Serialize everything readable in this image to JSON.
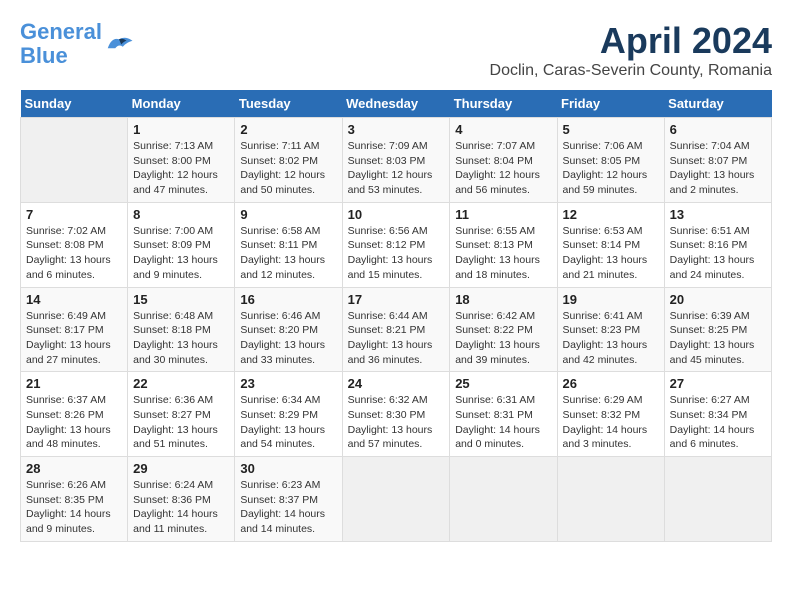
{
  "header": {
    "logo_line1": "General",
    "logo_line2": "Blue",
    "title": "April 2024",
    "subtitle": "Doclin, Caras-Severin County, Romania"
  },
  "calendar": {
    "days_of_week": [
      "Sunday",
      "Monday",
      "Tuesday",
      "Wednesday",
      "Thursday",
      "Friday",
      "Saturday"
    ],
    "weeks": [
      [
        {
          "day": "",
          "info": ""
        },
        {
          "day": "1",
          "info": "Sunrise: 7:13 AM\nSunset: 8:00 PM\nDaylight: 12 hours\nand 47 minutes."
        },
        {
          "day": "2",
          "info": "Sunrise: 7:11 AM\nSunset: 8:02 PM\nDaylight: 12 hours\nand 50 minutes."
        },
        {
          "day": "3",
          "info": "Sunrise: 7:09 AM\nSunset: 8:03 PM\nDaylight: 12 hours\nand 53 minutes."
        },
        {
          "day": "4",
          "info": "Sunrise: 7:07 AM\nSunset: 8:04 PM\nDaylight: 12 hours\nand 56 minutes."
        },
        {
          "day": "5",
          "info": "Sunrise: 7:06 AM\nSunset: 8:05 PM\nDaylight: 12 hours\nand 59 minutes."
        },
        {
          "day": "6",
          "info": "Sunrise: 7:04 AM\nSunset: 8:07 PM\nDaylight: 13 hours\nand 2 minutes."
        }
      ],
      [
        {
          "day": "7",
          "info": "Sunrise: 7:02 AM\nSunset: 8:08 PM\nDaylight: 13 hours\nand 6 minutes."
        },
        {
          "day": "8",
          "info": "Sunrise: 7:00 AM\nSunset: 8:09 PM\nDaylight: 13 hours\nand 9 minutes."
        },
        {
          "day": "9",
          "info": "Sunrise: 6:58 AM\nSunset: 8:11 PM\nDaylight: 13 hours\nand 12 minutes."
        },
        {
          "day": "10",
          "info": "Sunrise: 6:56 AM\nSunset: 8:12 PM\nDaylight: 13 hours\nand 15 minutes."
        },
        {
          "day": "11",
          "info": "Sunrise: 6:55 AM\nSunset: 8:13 PM\nDaylight: 13 hours\nand 18 minutes."
        },
        {
          "day": "12",
          "info": "Sunrise: 6:53 AM\nSunset: 8:14 PM\nDaylight: 13 hours\nand 21 minutes."
        },
        {
          "day": "13",
          "info": "Sunrise: 6:51 AM\nSunset: 8:16 PM\nDaylight: 13 hours\nand 24 minutes."
        }
      ],
      [
        {
          "day": "14",
          "info": "Sunrise: 6:49 AM\nSunset: 8:17 PM\nDaylight: 13 hours\nand 27 minutes."
        },
        {
          "day": "15",
          "info": "Sunrise: 6:48 AM\nSunset: 8:18 PM\nDaylight: 13 hours\nand 30 minutes."
        },
        {
          "day": "16",
          "info": "Sunrise: 6:46 AM\nSunset: 8:20 PM\nDaylight: 13 hours\nand 33 minutes."
        },
        {
          "day": "17",
          "info": "Sunrise: 6:44 AM\nSunset: 8:21 PM\nDaylight: 13 hours\nand 36 minutes."
        },
        {
          "day": "18",
          "info": "Sunrise: 6:42 AM\nSunset: 8:22 PM\nDaylight: 13 hours\nand 39 minutes."
        },
        {
          "day": "19",
          "info": "Sunrise: 6:41 AM\nSunset: 8:23 PM\nDaylight: 13 hours\nand 42 minutes."
        },
        {
          "day": "20",
          "info": "Sunrise: 6:39 AM\nSunset: 8:25 PM\nDaylight: 13 hours\nand 45 minutes."
        }
      ],
      [
        {
          "day": "21",
          "info": "Sunrise: 6:37 AM\nSunset: 8:26 PM\nDaylight: 13 hours\nand 48 minutes."
        },
        {
          "day": "22",
          "info": "Sunrise: 6:36 AM\nSunset: 8:27 PM\nDaylight: 13 hours\nand 51 minutes."
        },
        {
          "day": "23",
          "info": "Sunrise: 6:34 AM\nSunset: 8:29 PM\nDaylight: 13 hours\nand 54 minutes."
        },
        {
          "day": "24",
          "info": "Sunrise: 6:32 AM\nSunset: 8:30 PM\nDaylight: 13 hours\nand 57 minutes."
        },
        {
          "day": "25",
          "info": "Sunrise: 6:31 AM\nSunset: 8:31 PM\nDaylight: 14 hours\nand 0 minutes."
        },
        {
          "day": "26",
          "info": "Sunrise: 6:29 AM\nSunset: 8:32 PM\nDaylight: 14 hours\nand 3 minutes."
        },
        {
          "day": "27",
          "info": "Sunrise: 6:27 AM\nSunset: 8:34 PM\nDaylight: 14 hours\nand 6 minutes."
        }
      ],
      [
        {
          "day": "28",
          "info": "Sunrise: 6:26 AM\nSunset: 8:35 PM\nDaylight: 14 hours\nand 9 minutes."
        },
        {
          "day": "29",
          "info": "Sunrise: 6:24 AM\nSunset: 8:36 PM\nDaylight: 14 hours\nand 11 minutes."
        },
        {
          "day": "30",
          "info": "Sunrise: 6:23 AM\nSunset: 8:37 PM\nDaylight: 14 hours\nand 14 minutes."
        },
        {
          "day": "",
          "info": ""
        },
        {
          "day": "",
          "info": ""
        },
        {
          "day": "",
          "info": ""
        },
        {
          "day": "",
          "info": ""
        }
      ]
    ]
  }
}
